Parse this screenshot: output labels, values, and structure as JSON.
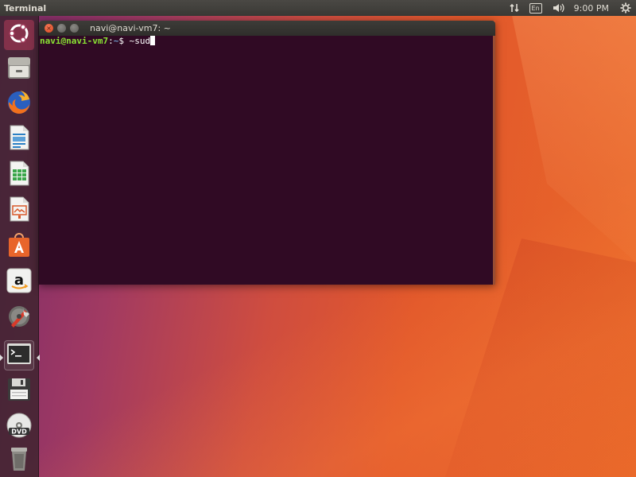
{
  "top_panel": {
    "app_title": "Terminal",
    "keyboard_layout": "En",
    "clock": "9:00 PM",
    "icons": [
      "network-arrows-icon",
      "keyboard-layout-icon",
      "volume-icon",
      "settings-gear-icon"
    ]
  },
  "launcher": {
    "items": [
      {
        "name": "ubuntu-dash",
        "icon": "ubuntu-logo-icon"
      },
      {
        "name": "files",
        "icon": "file-cabinet-icon"
      },
      {
        "name": "firefox",
        "icon": "firefox-icon"
      },
      {
        "name": "libreoffice-writer",
        "icon": "writer-doc-icon"
      },
      {
        "name": "libreoffice-calc",
        "icon": "calc-sheet-icon"
      },
      {
        "name": "libreoffice-impress",
        "icon": "impress-slide-icon"
      },
      {
        "name": "ubuntu-software",
        "icon": "software-bag-icon"
      },
      {
        "name": "amazon",
        "icon": "amazon-icon"
      },
      {
        "name": "system-settings",
        "icon": "settings-tools-icon"
      },
      {
        "name": "terminal",
        "icon": "terminal-icon",
        "active": true
      },
      {
        "name": "save-floppy",
        "icon": "floppy-disk-icon"
      },
      {
        "name": "dvd",
        "icon": "dvd-disc-icon",
        "label": "DVD"
      },
      {
        "name": "trash",
        "icon": "trash-icon"
      }
    ]
  },
  "terminal": {
    "title": "navi@navi-vm7: ~",
    "prompt_user": "navi@navi-vm7",
    "prompt_sep": ":",
    "prompt_path": "~",
    "prompt_symbol": "$ ",
    "input": "~sud",
    "colors": {
      "background": "#300a24",
      "user": "#8ae234",
      "path": "#729fcf",
      "text": "#ffffff"
    }
  }
}
